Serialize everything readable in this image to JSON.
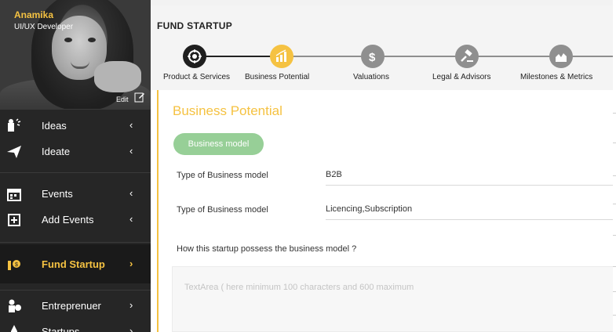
{
  "profile": {
    "name": "Anamika",
    "role": "UI/UX  Developer",
    "edit_label": "Edit"
  },
  "sidebar": {
    "groups": [
      {
        "items": [
          {
            "label": "Ideas",
            "icon": "ideas-icon",
            "chevron": "‹"
          },
          {
            "label": "Ideate",
            "icon": "paper-plane-icon",
            "chevron": "‹"
          }
        ]
      },
      {
        "items": [
          {
            "label": "Events",
            "icon": "calendar-icon",
            "chevron": "‹"
          },
          {
            "label": "Add Events",
            "icon": "add-box-icon",
            "chevron": "‹"
          }
        ]
      },
      {
        "items": [
          {
            "label": "Fund Startup",
            "icon": "money-hand-icon",
            "chevron": "›",
            "active": true
          }
        ]
      },
      {
        "items": [
          {
            "label": "Entreprenuer",
            "icon": "person-icon",
            "chevron": "›"
          },
          {
            "label": "Startups",
            "icon": "rocket-icon",
            "chevron": "›"
          }
        ]
      }
    ]
  },
  "header": {
    "title": "FUND STARTUP"
  },
  "steps": [
    {
      "label": "Product & Services",
      "icon": "target-icon",
      "state": "done"
    },
    {
      "label": "Business Potential",
      "icon": "bar-chart-icon",
      "state": "current"
    },
    {
      "label": "Valuations",
      "icon": "dollar-icon",
      "state": "pending"
    },
    {
      "label": "Legal & Advisors",
      "icon": "gavel-icon",
      "state": "pending"
    },
    {
      "label": "Milestones & Metrics",
      "icon": "area-chart-icon",
      "state": "pending"
    }
  ],
  "colors": {
    "accent": "#f5c242",
    "done": "#1f1f1f",
    "pending": "#8f8f8f",
    "pill": "#97cf97"
  },
  "form": {
    "section_title": "Business Potential",
    "pill_label": "Business model",
    "fields": [
      {
        "label": "Type of Business model",
        "value": "B2B"
      },
      {
        "label": "Type of Business model",
        "value": "Licencing,Subscription"
      }
    ],
    "question": "How this startup possess the business model ?",
    "textarea_placeholder": "TextArea ( here minimum 100 characters and 600 maximum"
  }
}
